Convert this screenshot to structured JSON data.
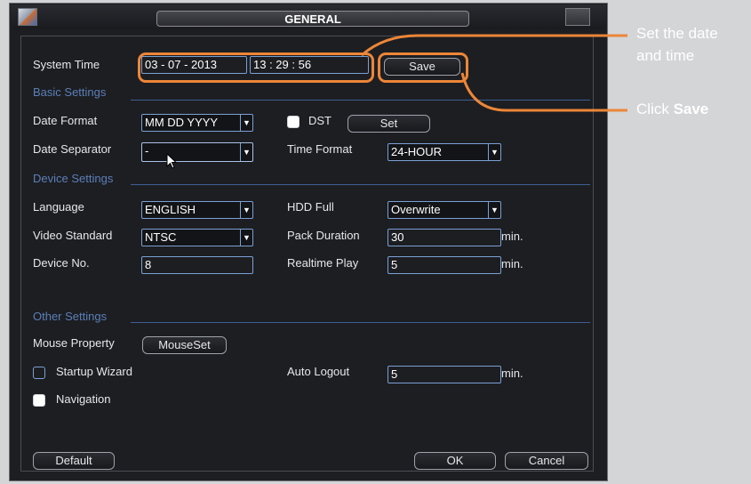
{
  "window": {
    "title": "GENERAL"
  },
  "system_time": {
    "label": "System Time",
    "date": "03 - 07 - 2013",
    "time": "13 : 29 : 56",
    "save_label": "Save"
  },
  "basic": {
    "heading": "Basic Settings",
    "date_format_label": "Date Format",
    "date_format_value": "MM DD YYYY",
    "dst_label": "DST",
    "dst_set_label": "Set",
    "date_separator_label": "Date Separator",
    "date_separator_value": "-",
    "time_format_label": "Time Format",
    "time_format_value": "24-HOUR"
  },
  "device": {
    "heading": "Device Settings",
    "language_label": "Language",
    "language_value": "ENGLISH",
    "hdd_full_label": "HDD Full",
    "hdd_full_value": "Overwrite",
    "video_standard_label": "Video Standard",
    "video_standard_value": "NTSC",
    "pack_duration_label": "Pack Duration",
    "pack_duration_value": "30",
    "pack_duration_unit": "min.",
    "device_no_label": "Device No.",
    "device_no_value": "8",
    "realtime_play_label": "Realtime Play",
    "realtime_play_value": "5",
    "realtime_play_unit": "min."
  },
  "other": {
    "heading": "Other Settings",
    "mouse_property_label": "Mouse Property",
    "mouse_set_label": "MouseSet",
    "startup_wizard_label": "Startup Wizard",
    "startup_wizard_checked": false,
    "auto_logout_label": "Auto Logout",
    "auto_logout_value": "5",
    "auto_logout_unit": "min.",
    "navigation_label": "Navigation",
    "navigation_checked": true
  },
  "footer": {
    "default_label": "Default",
    "ok_label": "OK",
    "cancel_label": "Cancel"
  },
  "annotations": {
    "set_date_line1": "Set the date",
    "set_date_line2": "and time",
    "click_prefix": "Click ",
    "click_bold": "Save"
  },
  "colors": {
    "highlight": "#ec8638",
    "field_border": "#7ba0d4",
    "section_heading": "#5b7fb8",
    "background": "#d4d5d7",
    "window": "#1d1e22"
  },
  "icons": [
    "app-icon",
    "dropdown-arrow-icon",
    "mouse-cursor-icon"
  ]
}
